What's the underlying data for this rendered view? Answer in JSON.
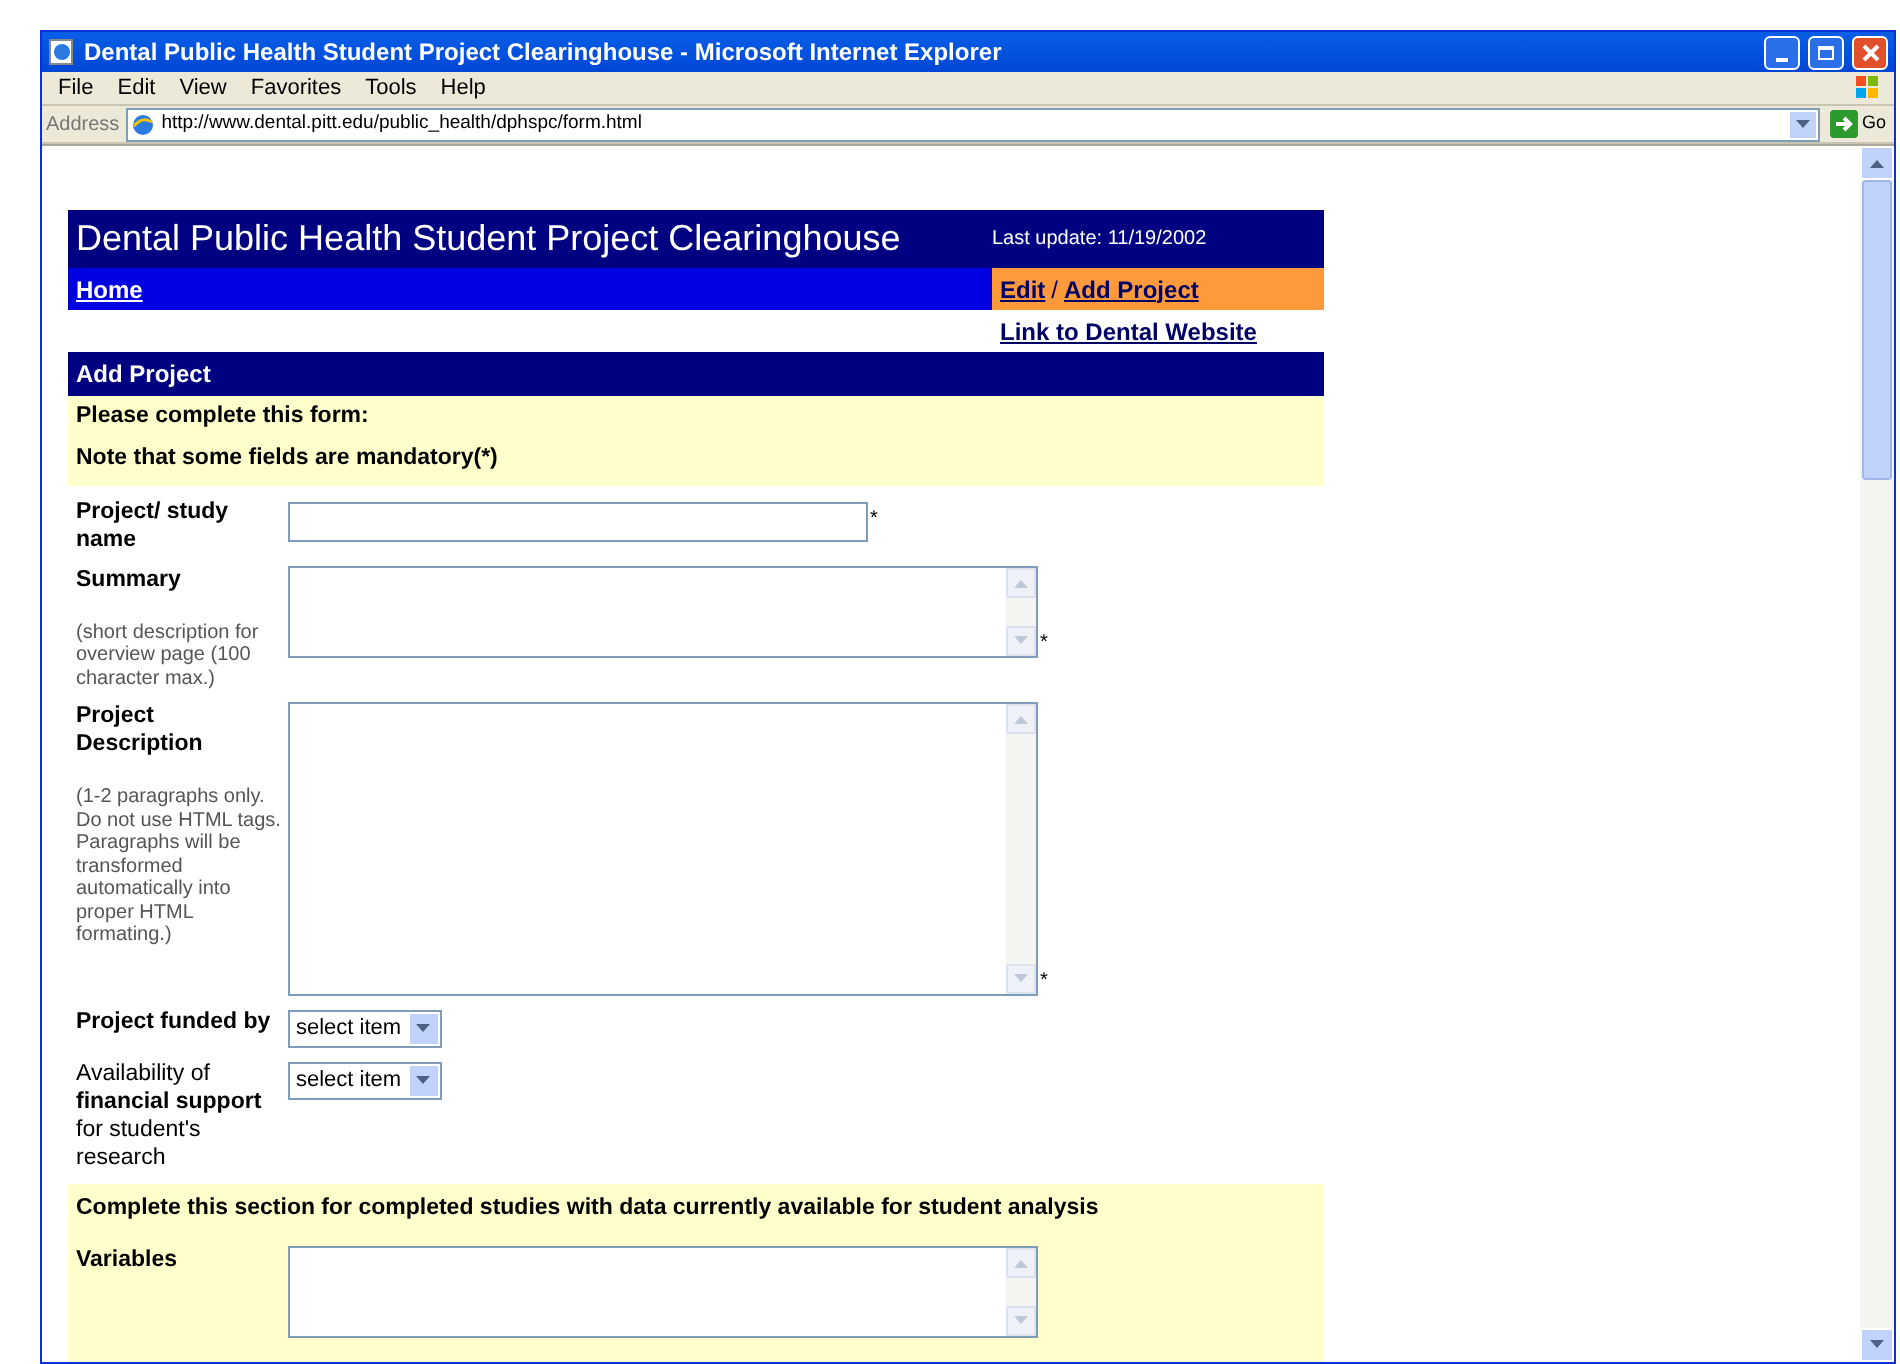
{
  "window": {
    "title": "Dental Public Health Student Project Clearinghouse - Microsoft Internet Explorer"
  },
  "menu": [
    "File",
    "Edit",
    "View",
    "Favorites",
    "Tools",
    "Help"
  ],
  "address_bar": {
    "label": "Address",
    "value": "http://www.dental.pitt.edu/public_health/dphspc/form.html",
    "go": "Go"
  },
  "header": {
    "title": "Dental Public Health Student Project Clearinghouse",
    "last_update": "Last update: 11/19/2002",
    "home_link": "Home",
    "edit_link": "Edit",
    "separator": "/",
    "add_link": "Add Project",
    "dental_link": "Link to Dental Website"
  },
  "section_title": "Add Project",
  "notes": [
    "Please complete this form:",
    "Note that some fields are mandatory(*)"
  ],
  "fields": [
    {
      "kind": "text",
      "label": "Project/ study name",
      "label_bold": true,
      "required_mark": "*"
    },
    {
      "kind": "textarea",
      "label": "Summary",
      "label_bold": true,
      "hint": "(short description for overview page (100 character max.)",
      "required_mark": "*"
    },
    {
      "kind": "textarea_large",
      "label": "Project Description",
      "label_bold": true,
      "hint": "(1-2 paragraphs only. Do not use HTML tags. Paragraphs will be transformed automatically into proper HTML formating.)",
      "required_mark": "*"
    },
    {
      "kind": "select",
      "label": "Project funded by",
      "label_bold": true,
      "value": "select item"
    },
    {
      "kind": "select",
      "label": "Availability of **financial support** for student's research",
      "label_bold": false,
      "value": "select item"
    }
  ],
  "section2": {
    "title": "Complete this section for completed studies with data currently available for student analysis",
    "fields": [
      {
        "kind": "textarea",
        "label": "Variables",
        "label_bold": true
      }
    ]
  }
}
